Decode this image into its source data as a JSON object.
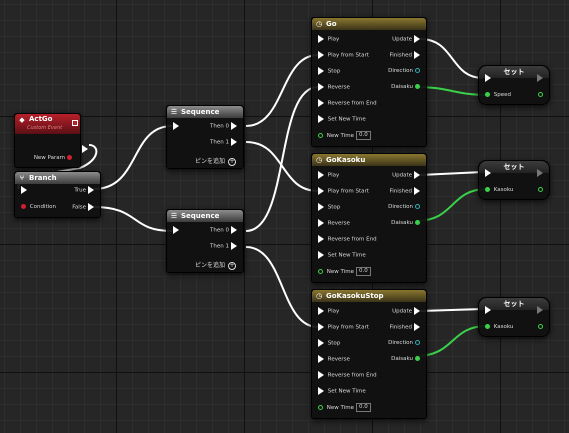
{
  "nodes": {
    "actgo": {
      "title": "ActGo",
      "subtitle": "Custom Event",
      "new_param": "New Param"
    },
    "branch": {
      "title": "Branch",
      "condition": "Condition",
      "true": "True",
      "false": "False"
    },
    "seq1": {
      "title": "Sequence",
      "then0": "Then 0",
      "then1": "Then 1",
      "add_pin": "ピンを追加"
    },
    "seq2": {
      "title": "Sequence",
      "then0": "Then 0",
      "then1": "Then 1",
      "add_pin": "ピンを追加"
    },
    "go": {
      "title": "Go",
      "play": "Play",
      "play_from_start": "Play from Start",
      "stop": "Stop",
      "reverse": "Reverse",
      "reverse_from_end": "Reverse from End",
      "set_new_time": "Set New Time",
      "new_time": "New Time",
      "new_time_value": "0.0",
      "update": "Update",
      "finished": "Finished",
      "direction": "Direction",
      "output": "Daisaku"
    },
    "gokasoku": {
      "title": "GoKasoku",
      "play": "Play",
      "play_from_start": "Play from Start",
      "stop": "Stop",
      "reverse": "Reverse",
      "reverse_from_end": "Reverse from End",
      "set_new_time": "Set New Time",
      "new_time": "New Time",
      "new_time_value": "0.0",
      "update": "Update",
      "finished": "Finished",
      "direction": "Direction",
      "output": "Daisaku"
    },
    "gokasokustop": {
      "title": "GoKasokuStop",
      "play": "Play",
      "play_from_start": "Play from Start",
      "stop": "Stop",
      "reverse": "Reverse",
      "reverse_from_end": "Reverse from End",
      "set_new_time": "Set New Time",
      "new_time": "New Time",
      "new_time_value": "0.0",
      "update": "Update",
      "finished": "Finished",
      "direction": "Direction",
      "output": "Daisaku"
    },
    "set1": {
      "title": "セット",
      "param": "Speed"
    },
    "set2": {
      "title": "セット",
      "param": "Kasoku"
    },
    "set3": {
      "title": "セット",
      "param": "Kasoku"
    }
  },
  "colors": {
    "exec_wire": "#ffffff",
    "float_wire": "#3bd04a",
    "timeline_header": "#8a7730",
    "event_header": "#b8202a",
    "grid": "#262626"
  }
}
